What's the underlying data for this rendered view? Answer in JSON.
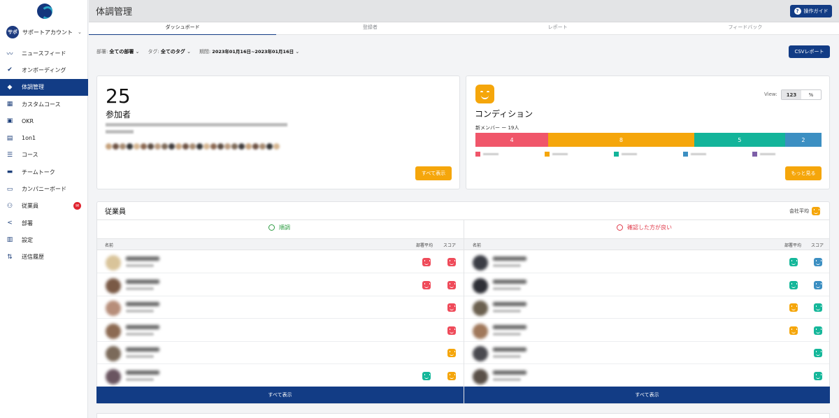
{
  "sidebar": {
    "account": {
      "avatar_text": "サポ",
      "name": "サポートアカウント",
      "caret": "⌄"
    },
    "items": [
      {
        "label": "ニュースフィード",
        "icon": "trend-icon"
      },
      {
        "label": "オンボーディング",
        "icon": "check-circle-icon"
      },
      {
        "label": "体調管理",
        "icon": "tag-icon",
        "active": true
      },
      {
        "label": "カスタムコース",
        "icon": "grid-icon"
      },
      {
        "label": "OKR",
        "icon": "book-icon"
      },
      {
        "label": "1on1",
        "icon": "calendar-icon"
      },
      {
        "label": "コース",
        "icon": "list-icon"
      },
      {
        "label": "チームトーク",
        "icon": "chat-icon"
      },
      {
        "label": "カンパニーボード",
        "icon": "board-icon"
      },
      {
        "label": "従業員",
        "icon": "people-icon",
        "badge": true
      },
      {
        "label": "部署",
        "icon": "share-icon"
      },
      {
        "label": "設定",
        "icon": "building-icon"
      },
      {
        "label": "送信履歴",
        "icon": "sort-icon"
      }
    ]
  },
  "header": {
    "title": "体調管理",
    "guide_button": "操作ガイド"
  },
  "tabs": [
    "ダッシュボード",
    "登録者",
    "レポート",
    "フィードバック"
  ],
  "filters": {
    "department_label": "部署:",
    "department_value": "全ての部署",
    "tag_label": "タグ:",
    "tag_value": "全てのタグ",
    "period_label": "期間:",
    "period_value": "2023年01月16日~2023年01月16日",
    "csv_button": "CSVレポート"
  },
  "participants": {
    "count": "25",
    "label": "参加者",
    "show_all": "すべて表示"
  },
  "condition": {
    "title": "コンディション",
    "view_label": "View:",
    "view_options": [
      "123",
      "%"
    ],
    "new_members": "新メンバー ー 19人",
    "more_button": "もっと見る",
    "segments": [
      {
        "value": 4,
        "color": "#f0566a"
      },
      {
        "value": 8,
        "color": "#f5a60b"
      },
      {
        "value": 5,
        "color": "#13b49a"
      },
      {
        "value": 2,
        "color": "#3c8fc2"
      }
    ],
    "legend_colors": [
      "#f0566a",
      "#f5a60b",
      "#13b49a",
      "#3c8fc2",
      "#7d5fa8"
    ]
  },
  "employees": {
    "title": "従業員",
    "company_avg": "会社平均",
    "good_header": "順調",
    "bad_header": "確認した方が良い",
    "col_name": "名前",
    "col_dept_avg": "部署平均",
    "col_score": "スコア",
    "show_all": "すべて表示",
    "left_rows": [
      {
        "avatar": "#d9c49a",
        "dept": "red",
        "score": "red"
      },
      {
        "avatar": "#7a5a46",
        "dept": "red",
        "score": "red"
      },
      {
        "avatar": "#b78e7a",
        "dept": "",
        "score": "red"
      },
      {
        "avatar": "#8c6a52",
        "dept": "",
        "score": "red"
      },
      {
        "avatar": "#7b6a5a",
        "dept": "",
        "score": "yellow"
      },
      {
        "avatar": "#6a5560",
        "dept": "green",
        "score": "yellow"
      }
    ],
    "right_rows": [
      {
        "avatar": "#3b3d45",
        "dept": "green",
        "score": "blue"
      },
      {
        "avatar": "#2e2f36",
        "dept": "green",
        "score": "blue"
      },
      {
        "avatar": "#6b604f",
        "dept": "yellow",
        "score": "green"
      },
      {
        "avatar": "#a0785a",
        "dept": "yellow",
        "score": "green"
      },
      {
        "avatar": "#4a4a50",
        "dept": "",
        "score": "green"
      },
      {
        "avatar": "#5a5048",
        "dept": "",
        "score": "green"
      }
    ]
  }
}
